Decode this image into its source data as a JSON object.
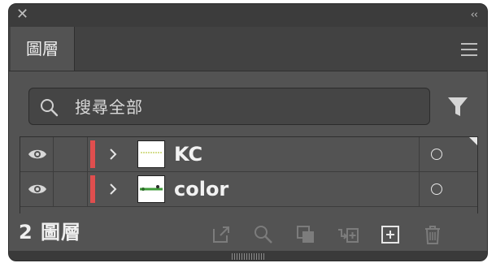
{
  "panel": {
    "tab_label": "圖層",
    "collapse_glyph": "‹‹",
    "close_glyph": "✕"
  },
  "search": {
    "placeholder": "搜尋全部"
  },
  "layers": [
    {
      "name": "KC",
      "color": "#e04e4e",
      "expanded": false,
      "visible": true
    },
    {
      "name": "color",
      "color": "#e04e4e",
      "expanded": false,
      "visible": true
    }
  ],
  "footer": {
    "count_label": "2 圖層"
  },
  "colors": {
    "panel_bg": "#535353",
    "layer_color": "#e04e4e",
    "thumb_art_kc": "#c9d46a",
    "thumb_art_color": "#3f9b3a"
  }
}
